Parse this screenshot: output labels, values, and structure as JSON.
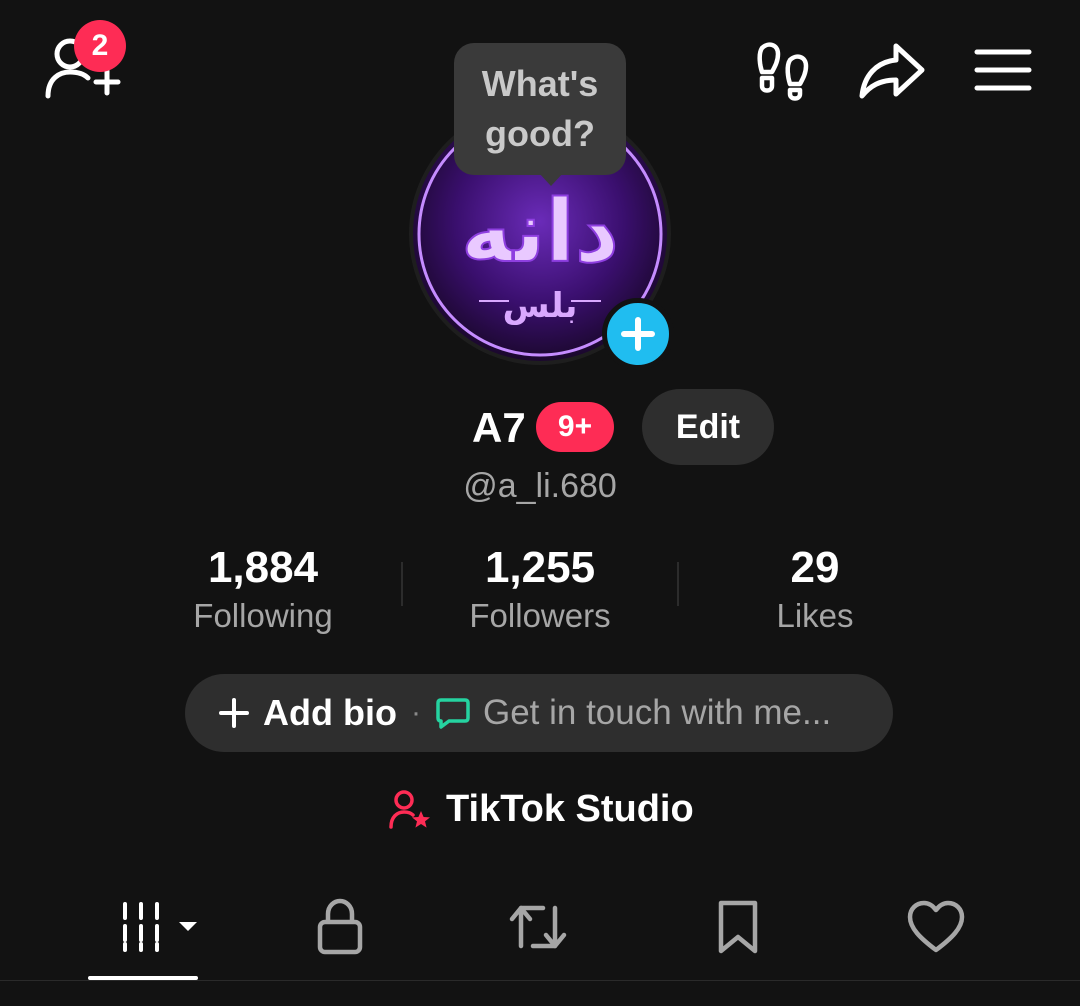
{
  "header": {
    "add_friends_badge": "2",
    "icons": [
      "add-friends-icon",
      "footprints-icon",
      "share-icon",
      "menu-icon"
    ]
  },
  "tooltip": {
    "text": "What's good?"
  },
  "profile": {
    "name": "A7",
    "notification_badge": "9+",
    "edit_label": "Edit",
    "handle": "@a_li.680",
    "avatar_text_main": "دانه",
    "avatar_text_sub": "بلس"
  },
  "stats": [
    {
      "value": "1,884",
      "label": "Following"
    },
    {
      "value": "1,255",
      "label": "Followers"
    },
    {
      "value": "29",
      "label": "Likes"
    }
  ],
  "bio": {
    "add_label": "Add bio",
    "separator": "·",
    "contact_label": "Get in touch with me..."
  },
  "studio": {
    "label": "TikTok Studio"
  },
  "tabs": [
    {
      "name": "videos",
      "icon": "grid-icon",
      "active": true
    },
    {
      "name": "private",
      "icon": "lock-icon",
      "active": false
    },
    {
      "name": "reposts",
      "icon": "repost-icon",
      "active": false
    },
    {
      "name": "favorites",
      "icon": "bookmark-icon",
      "active": false
    },
    {
      "name": "liked",
      "icon": "heart-icon",
      "active": false
    }
  ],
  "colors": {
    "background": "#121212",
    "accent_red": "#fe2c55",
    "accent_blue": "#20bdf0",
    "accent_green": "#25d3a0",
    "pill_bg": "#2e2e2e"
  }
}
